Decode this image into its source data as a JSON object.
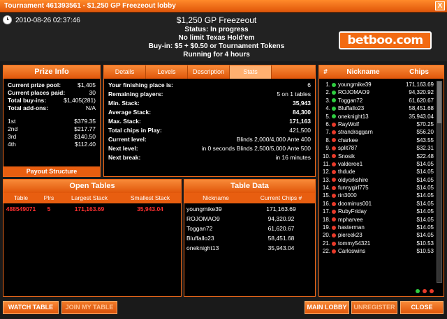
{
  "window": {
    "title": "Tournament 461393561 - $1,250 GP Freezeout lobby",
    "close": "X"
  },
  "header": {
    "datetime": "2010-08-26 02:37:46",
    "name": "$1,250 GP Freezeout",
    "status": "Status: In progress",
    "game": "No limit Texas Hold'em",
    "buyin": "Buy-in: $5 + $0.50 or Tournament Tokens",
    "running": "Running for 4 hours",
    "logo": "betboo.com"
  },
  "prize": {
    "title": "Prize Info",
    "rows": [
      {
        "label": "Current prize pool:",
        "value": "$1,405"
      },
      {
        "label": "Current places paid:",
        "value": "30"
      },
      {
        "label": "Total buy-ins:",
        "value": "$1,405(281)"
      },
      {
        "label": "Total add-ons:",
        "value": "N/A"
      }
    ],
    "places": [
      {
        "label": "1st",
        "value": "$379.35"
      },
      {
        "label": "2nd",
        "value": "$217.77"
      },
      {
        "label": "3rd",
        "value": "$140.50"
      },
      {
        "label": "4th",
        "value": "$112.40"
      }
    ],
    "payout_button": "Payout Structure"
  },
  "stats": {
    "tabs": [
      "Details",
      "Levels",
      "Description",
      "Stats"
    ],
    "rows": [
      {
        "label": "Your finishing place is:",
        "value": "6"
      },
      {
        "label": "Remaining players:",
        "value": "5 on 1 tables"
      },
      {
        "label": "Min. Stack:",
        "value": "35,943"
      },
      {
        "label": "Average Stack:",
        "value": "84,300"
      },
      {
        "label": "Max. Stack:",
        "value": "171,163"
      },
      {
        "label": "Total chips in Play:",
        "value": "421,500"
      },
      {
        "label": "Current level:",
        "value": "Blinds 2,000/4,000 Ante 400"
      },
      {
        "label": "Next level:",
        "value": "in 0 seconds Blinds 2,500/5,000 Ante 500"
      },
      {
        "label": "Next break:",
        "value": "in 16 minutes"
      }
    ]
  },
  "players": {
    "headers": [
      "#",
      "Nickname",
      "Chips"
    ],
    "rows": [
      {
        "n": "1.",
        "name": "youngmike39",
        "chips": "171,163.69",
        "status": "green"
      },
      {
        "n": "2.",
        "name": "ROJOMAO9",
        "chips": "94,320.92",
        "status": "green"
      },
      {
        "n": "3.",
        "name": "Toggan72",
        "chips": "61,620.67",
        "status": "green"
      },
      {
        "n": "4.",
        "name": "Bluffallo23",
        "chips": "58,451.68",
        "status": "green"
      },
      {
        "n": "5.",
        "name": "oneknight13",
        "chips": "35,943.04",
        "status": "green"
      },
      {
        "n": "6.",
        "name": "RayWolf",
        "chips": "$70.25",
        "status": "red"
      },
      {
        "n": "7.",
        "name": "strandraggarn",
        "chips": "$56.20",
        "status": "red"
      },
      {
        "n": "8.",
        "name": "charkee",
        "chips": "$43.55",
        "status": "red"
      },
      {
        "n": "9.",
        "name": "split787",
        "chips": "$32.31",
        "status": "red"
      },
      {
        "n": "10.",
        "name": "Snosik",
        "chips": "$22.48",
        "status": "red"
      },
      {
        "n": "11.",
        "name": "valderee1",
        "chips": "$14.05",
        "status": "red"
      },
      {
        "n": "12.",
        "name": "thdude",
        "chips": "$14.05",
        "status": "red"
      },
      {
        "n": "13.",
        "name": "oldyorkshire",
        "chips": "$14.05",
        "status": "red"
      },
      {
        "n": "14.",
        "name": "funnygirl775",
        "chips": "$14.05",
        "status": "red"
      },
      {
        "n": "15.",
        "name": "rin3000",
        "chips": "$14.05",
        "status": "red"
      },
      {
        "n": "16.",
        "name": "doominus001",
        "chips": "$14.05",
        "status": "red"
      },
      {
        "n": "17.",
        "name": "RubyFriday",
        "chips": "$14.05",
        "status": "red"
      },
      {
        "n": "18.",
        "name": "mpharvee",
        "chips": "$14.05",
        "status": "red"
      },
      {
        "n": "19.",
        "name": "hasterman",
        "chips": "$14.05",
        "status": "red"
      },
      {
        "n": "20.",
        "name": "piercek23",
        "chips": "$14.05",
        "status": "red"
      },
      {
        "n": "21.",
        "name": "tommy54321",
        "chips": "$10.53",
        "status": "red"
      },
      {
        "n": "22.",
        "name": "Carloswins",
        "chips": "$10.53",
        "status": "red"
      }
    ]
  },
  "open_tables": {
    "title": "Open Tables",
    "headers": [
      "Table",
      "Plrs",
      "Largest Stack",
      "Smallest Stack"
    ],
    "rows": [
      {
        "table": "488549071",
        "plrs": "5",
        "largest": "171,163.69",
        "smallest": "35,943.04"
      }
    ]
  },
  "table_data": {
    "title": "Table Data",
    "headers": [
      "Nickname",
      "Current Chips #"
    ],
    "rows": [
      {
        "name": "youngmike39",
        "chips": "171,163.69"
      },
      {
        "name": "ROJOMAO9",
        "chips": "94,320.92"
      },
      {
        "name": "Toggan72",
        "chips": "61,620.67"
      },
      {
        "name": "Bluffallo23",
        "chips": "58,451.68"
      },
      {
        "name": "oneknight13",
        "chips": "35,943.04"
      }
    ]
  },
  "buttons": {
    "watch": "WATCH TABLE",
    "join": "JOIN MY TABLE",
    "main_lobby": "MAIN LOBBY",
    "unregister": "UNREGISTER",
    "close": "CLOSE"
  },
  "colors": {
    "accent": "#f06818",
    "status_green": "#2ecc40",
    "status_red": "#e83a2a",
    "highlight_red": "#ff3030"
  }
}
